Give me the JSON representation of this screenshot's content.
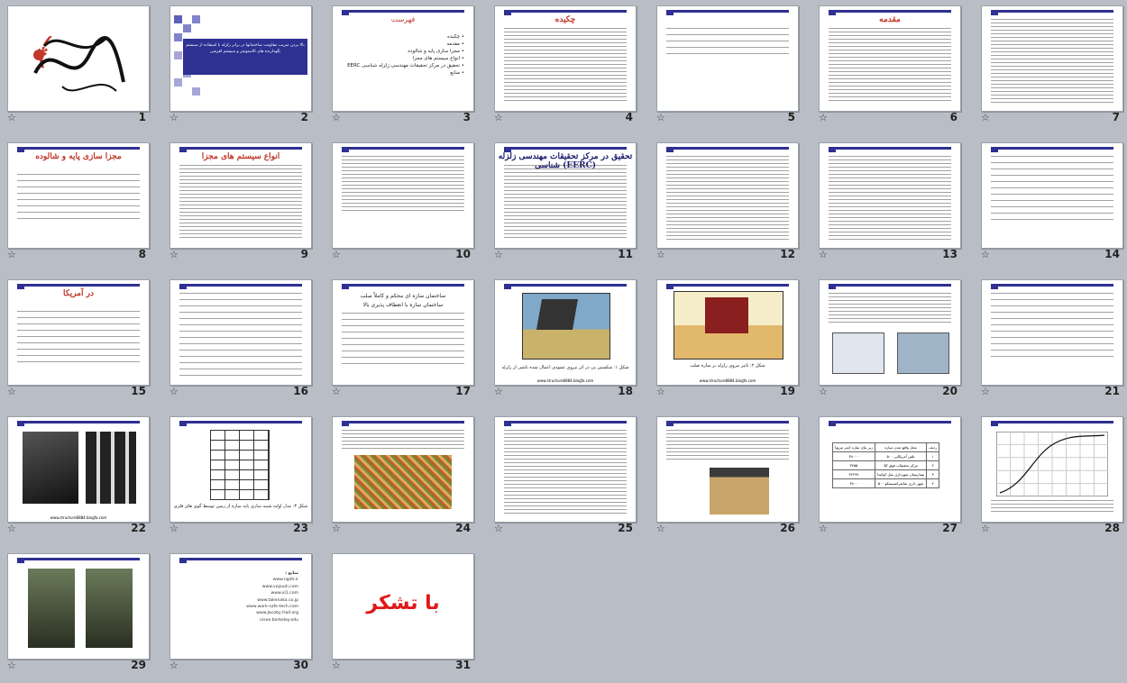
{
  "slides": [
    {
      "n": "1"
    },
    {
      "n": "2"
    },
    {
      "n": "3"
    },
    {
      "n": "4"
    },
    {
      "n": "5"
    },
    {
      "n": "6"
    },
    {
      "n": "7"
    },
    {
      "n": "8"
    },
    {
      "n": "9"
    },
    {
      "n": "10"
    },
    {
      "n": "11"
    },
    {
      "n": "12"
    },
    {
      "n": "13"
    },
    {
      "n": "14"
    },
    {
      "n": "15"
    },
    {
      "n": "16"
    },
    {
      "n": "17"
    },
    {
      "n": "18"
    },
    {
      "n": "19"
    },
    {
      "n": "20"
    },
    {
      "n": "21"
    },
    {
      "n": "22"
    },
    {
      "n": "23"
    },
    {
      "n": "24"
    },
    {
      "n": "25"
    },
    {
      "n": "26"
    },
    {
      "n": "27"
    },
    {
      "n": "28"
    },
    {
      "n": "29"
    },
    {
      "n": "30"
    },
    {
      "n": "31"
    }
  ],
  "star_glyph": "☆",
  "texts": {
    "s2_title": "بالا بردن ضریب مقاومت ساختمانها در برابر زلزله با استفاده از سیستم نگهدارنده های الاستومتر و سیستم لغزشی",
    "s3_title": "فهرست",
    "s3_items": [
      "چکیده",
      "مقدمه",
      "مجزا سازی پایه و شالوده",
      "انواع سیستم های مجزا",
      "تحقیق در مرکز تحقیقات مهندسی زلزله شناسی EERC",
      "منابع"
    ],
    "s4_title": "چکیده",
    "s6_title": "مقدمه",
    "s8_title": "مجزا سازی پایه و شالوده",
    "s9_title": "انواع سیستم های مجزا",
    "s11_title": "تحقیق در مرکز تحقیقات مهندسی زلزله شناسی (EERC)",
    "s15_title": "در آمریکا",
    "s17_lines": [
      "ساختمان سازه ای محکم و کاملاً صلب",
      "ساختمان سازه با انعطاف پذیری بالا"
    ],
    "s18_caption": "شکل ۱: شکستن پی در اثر نیروی عمودی اعمال شده ناشی از زلزله",
    "s19_caption": "شکل ۲: تاثیر نیروی زلزله بر سازه صلب",
    "s23_caption": "شکل ۳: مدل اولیه شبیه سازی پایه سازه از زمین توسط گوی های فلزی",
    "s30_title": "منابع :",
    "s30_lines": [
      "www.ngdir.ir",
      "www.vojoudi.com",
      "www.xl1.com",
      "www.takenaka.co.jp",
      "www.work-safe-tech.com",
      "www.Jacoby Hall.org",
      "nisee.berkeley.edu"
    ],
    "s31_thanks": "با تشکر",
    "footer_url": "www.structure8884.blogfa.com"
  },
  "s27_table": {
    "headers": [
      "ردیف",
      "محل واقع شدن سازه",
      "زیر بنای سازه (متر مربع)"
    ],
    "rows": [
      [
        "۱",
        "۵۰۰ تلفن آمریکایی",
        "۳۸۰۰۰"
      ],
      [
        "۲",
        "مرکز تحقیقات فوق کلا",
        "۳۴۵۵"
      ],
      [
        "۳",
        "بیمارستان شهرداری مثل کوکیدا",
        "۳۲۲۹۷"
      ],
      [
        "۴",
        "۵۰۰ شهر داری سانفرانسیسکو",
        "۳۸۰۰"
      ]
    ]
  }
}
